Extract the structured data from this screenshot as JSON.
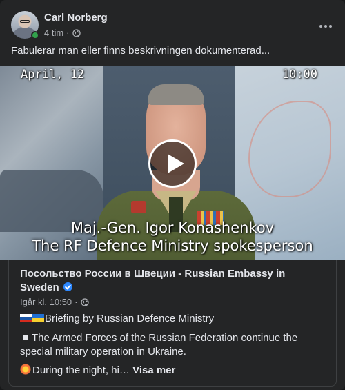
{
  "post": {
    "author": "Carl Norberg",
    "time": "4 tim",
    "separator": "·",
    "text": "Fabulerar man eller finns beskrivningen dokumenterad..."
  },
  "video": {
    "date": "April, 12",
    "time": "10:00",
    "caption_line1": "Maj.-Gen. Igor Konashenkov",
    "caption_line2": "The RF Defence Ministry spokesperson"
  },
  "shared": {
    "title": "Посольство России в Швеции - Russian Embassy in Sweden",
    "time": "Igår kl. 10:50",
    "separator": "·",
    "line1": "Briefing by Russian Defence Ministry",
    "line2": "The Armed Forces of the Russian Federation continue the special military operation in Ukraine.",
    "line3": "During the night, hi…",
    "see_more": "Visa mer"
  },
  "icons": {
    "privacy": "globe-icon",
    "verified": "verified-badge-icon",
    "more": "more-options-icon",
    "play": "play-icon"
  },
  "colors": {
    "card_bg": "#242526",
    "text_primary": "#e4e6eb",
    "text_secondary": "#b0b3b8",
    "verified": "#2d88ff",
    "online": "#31a24c"
  }
}
